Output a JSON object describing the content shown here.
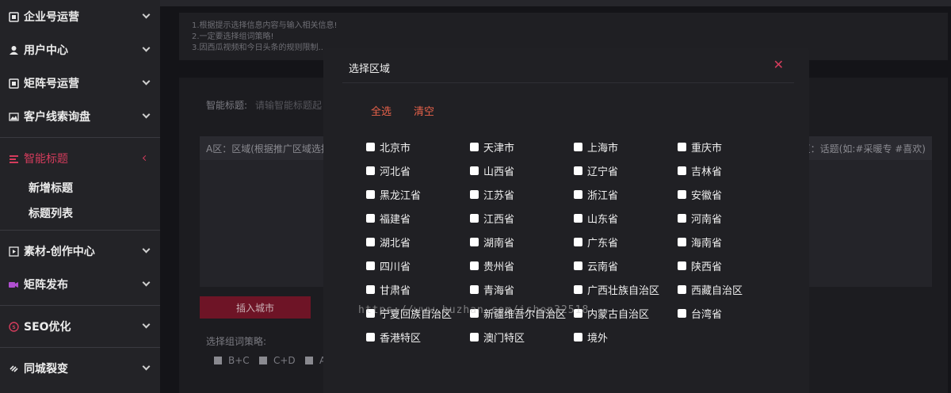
{
  "sidebar": {
    "items": [
      {
        "label": "企业号运营",
        "icon": "building-icon"
      },
      {
        "label": "用户中心",
        "icon": "user-icon"
      },
      {
        "label": "矩阵号运营",
        "icon": "building-icon"
      },
      {
        "label": "客户线索询盘",
        "icon": "image-icon"
      }
    ],
    "active": {
      "label": "智能标题",
      "icon": "title-icon"
    },
    "submenu": [
      "新增标题",
      "标题列表"
    ],
    "items_after": [
      {
        "label": "素材-创作中心",
        "icon": "film-icon"
      },
      {
        "label": "矩阵发布",
        "icon": "video-icon"
      }
    ],
    "seo": {
      "label": "SEO优化",
      "icon": "seo-icon"
    },
    "city": {
      "label": "同城裂变",
      "icon": "link-icon"
    },
    "accent_color": "#d43c5c"
  },
  "notice": {
    "lines": [
      "1.根据提示选择信息内容与输入相关信息!",
      "2.一定要选择组词策略!",
      "3.因西瓜视频和今日头条的规则限制..."
    ]
  },
  "form": {
    "title_label": "智能标题:",
    "title_placeholder": "请输智能标题起",
    "area_a_label": "A区：区域(根据推广区域选择",
    "area_e_label": "E区：话题(如:#采暖专 #喜欢)",
    "insert_button": "插入城市",
    "strategy_label": "选择组词策略:",
    "strategies": [
      "B+C",
      "C+D",
      "A"
    ]
  },
  "modal": {
    "title": "选择区域",
    "close_icon": "close-icon",
    "select_all": "全选",
    "clear": "清空",
    "regions": [
      "北京市",
      "天津市",
      "上海市",
      "重庆市",
      "河北省",
      "山西省",
      "辽宁省",
      "吉林省",
      "黑龙江省",
      "江苏省",
      "浙江省",
      "安徽省",
      "福建省",
      "江西省",
      "山东省",
      "河南省",
      "湖北省",
      "湖南省",
      "广东省",
      "海南省",
      "四川省",
      "贵州省",
      "云南省",
      "陕西省",
      "甘肃省",
      "青海省",
      "广西壮族自治区",
      "西藏自治区",
      "宁夏回族自治区",
      "新疆维吾尔自治区",
      "内蒙古自治区",
      "台湾省",
      "香港特区",
      "澳门特区",
      "境外"
    ],
    "action_color": "#e8624a"
  },
  "watermark": "https://www.huzhan.com/ishop32518"
}
